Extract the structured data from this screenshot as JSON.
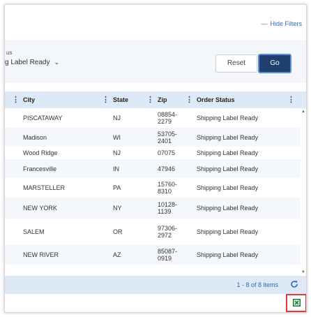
{
  "header": {
    "hide_filters": "Hide Filters",
    "hide_filters_prefix": "—"
  },
  "filters": {
    "status_label": "us",
    "status_value": "g Label Ready",
    "reset_label": "Reset",
    "go_label": "Go"
  },
  "table": {
    "columns": [
      "City",
      "State",
      "Zip",
      "Order Status"
    ],
    "rows": [
      {
        "city": "PISCATAWAY",
        "state": "NJ",
        "zip": "08854-\n2279",
        "status": "Shipping Label Ready"
      },
      {
        "city": "Madison",
        "state": "WI",
        "zip": "53705-\n2401",
        "status": "Shipping Label Ready"
      },
      {
        "city": "Wood Ridge",
        "state": "NJ",
        "zip": "07075",
        "status": "Shipping Label Ready"
      },
      {
        "city": "Francesville",
        "state": "IN",
        "zip": "47946",
        "status": "Shipping Label Ready"
      },
      {
        "city": "MARSTELLER",
        "state": "PA",
        "zip": "15760-\n8310",
        "status": "Shipping Label Ready"
      },
      {
        "city": "NEW YORK",
        "state": "NY",
        "zip": "10128-\n1139",
        "status": "Shipping Label Ready"
      },
      {
        "city": "SALEM",
        "state": "OR",
        "zip": "97306-\n2972",
        "status": "Shipping Label Ready"
      },
      {
        "city": "NEW RIVER",
        "state": "AZ",
        "zip": "85087-\n0919",
        "status": "Shipping Label Ready"
      }
    ]
  },
  "footer": {
    "items_count": "1 - 8 of 8 items"
  },
  "icons": {
    "kebab": "kebab-menu-icon",
    "refresh": "refresh-icon",
    "excel": "excel-export-icon",
    "chevron": "chevron-down-icon"
  },
  "colors": {
    "header_bg": "#dde9f7",
    "go_button": "#1f3f6e",
    "link": "#2b6cb0",
    "highlight": "#e03a3a",
    "excel_green": "#1e7b34"
  }
}
